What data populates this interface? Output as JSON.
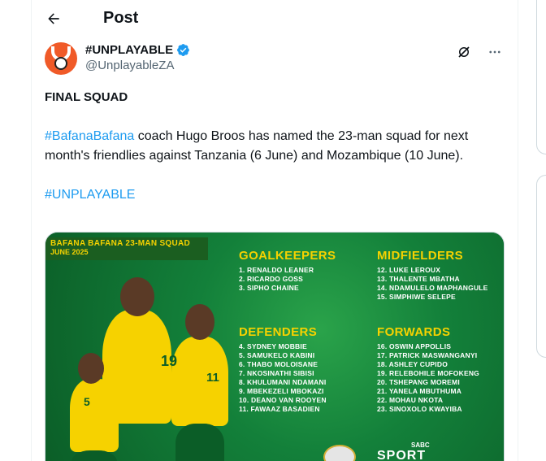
{
  "header": {
    "title": "Post"
  },
  "author": {
    "display_name": "#UNPLAYABLE",
    "handle": "@UnplayableZA",
    "verified": true
  },
  "actions": {
    "grok_icon": "grok-icon",
    "more_icon": "more-icon"
  },
  "tweet": {
    "headline": "FINAL SQUAD",
    "hashtag1": "#BafanaBafana",
    "text": " coach Hugo Broos has named the 23-man squad for next month's friendlies against Tanzania (6 June) and Mozambique (10 June).",
    "hashtag2": "#UNPLAYABLE"
  },
  "media": {
    "banner_title": "BAFANA BAFANA 23-MAN SQUAD",
    "banner_date": "JUNE 2025",
    "goalkeepers": {
      "heading": "GOALKEEPERS",
      "players": [
        "1. RENALDO LEANER",
        "2. RICARDO GOSS",
        "3. SIPHO CHAINE"
      ]
    },
    "defenders": {
      "heading": "DEFENDERS",
      "players": [
        "4. SYDNEY MOBBIE",
        "5. SAMUKELO KABINI",
        "6. THABO MOLOISANE",
        "7. NKOSINATHI SIBISI",
        "8. KHULUMANI NDAMANI",
        "9. MBEKEZELI MBOKAZI",
        "10. DEANO VAN ROOYEN",
        "11. FAWAAZ BASADIEN"
      ]
    },
    "midfielders": {
      "heading": "MIDFIELDERS",
      "players": [
        "12. LUKE LEROUX",
        "13. THALENTE MBATHA",
        "14. NDAMULELO MAPHANGULE",
        "15. SIMPHIWE SELEPE"
      ]
    },
    "forwards": {
      "heading": "FORWARDS",
      "players": [
        "16. OSWIN APPOLLIS",
        "17. PATRICK MASWANGANYI",
        "18. ASHLEY CUPIDO",
        "19. RELEBOHILE MOFOKENG",
        "20. TSHEPANG MOREMI",
        "21. YANELA MBUTHUMA",
        "22. MOHAU NKOTA",
        "23. SINOXOLO KWAYIBA"
      ]
    },
    "jersey_numbers": [
      "19",
      "5",
      "11"
    ],
    "sponsor_small": "SABC",
    "sponsor_large": "SPORT"
  },
  "colors": {
    "accent": "#1d9bf0",
    "brand_green": "#13803a",
    "brand_yellow": "#f6d200",
    "avatar_bg": "#f05a28"
  }
}
